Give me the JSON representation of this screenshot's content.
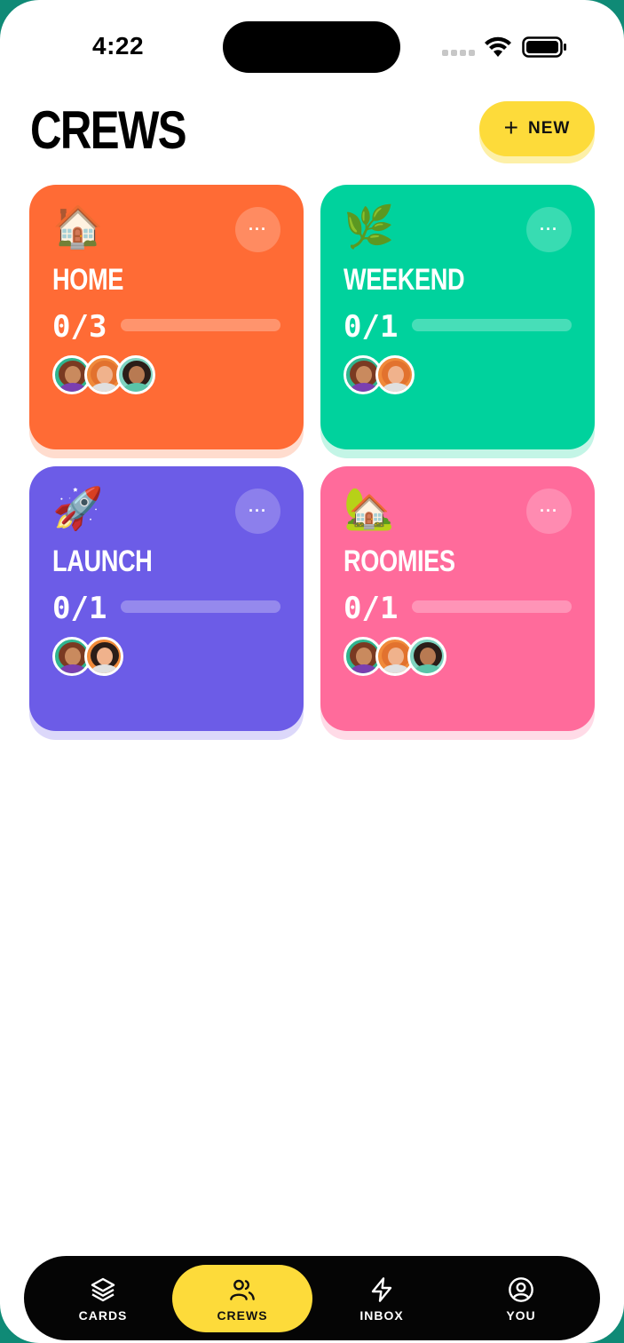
{
  "status": {
    "time": "4:22"
  },
  "header": {
    "title": "CREWS",
    "new_label": "NEW"
  },
  "crews": [
    {
      "name": "HOME",
      "emoji": "🏠",
      "count": "0/3",
      "progress": 0,
      "color": "#ff6b35",
      "shadow": "#ffdcce",
      "avatars": [
        "#7a3a22",
        "#e2722e",
        "#2b1d18"
      ]
    },
    {
      "name": "WEEKEND",
      "emoji": "🌿",
      "count": "0/1",
      "progress": 0,
      "color": "#00d29d",
      "shadow": "#c3f5e6",
      "avatars": [
        "#7a3a22",
        "#e2722e"
      ]
    },
    {
      "name": "LAUNCH",
      "emoji": "🚀",
      "count": "0/1",
      "progress": 0,
      "color": "#6c5ce7",
      "shadow": "#dcd8fa",
      "avatars": [
        "#7a3a22",
        "#2b1d18"
      ]
    },
    {
      "name": "ROOMIES",
      "emoji": "🏡",
      "count": "0/1",
      "progress": 0,
      "color": "#ff6b9b",
      "shadow": "#ffdbe7",
      "avatars": [
        "#7a3a22",
        "#e2722e",
        "#2b1d18"
      ]
    }
  ],
  "tabs": [
    {
      "label": "CARDS",
      "icon": "layers-icon"
    },
    {
      "label": "CREWS",
      "icon": "users-icon",
      "active": true
    },
    {
      "label": "INBOX",
      "icon": "bolt-icon"
    },
    {
      "label": "YOU",
      "icon": "user-circle-icon"
    }
  ]
}
